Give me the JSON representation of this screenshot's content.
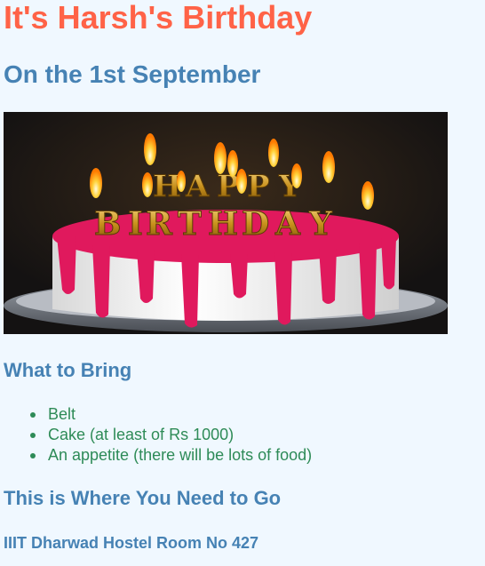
{
  "page": {
    "title": "It's Harsh's Birthday",
    "date": "On the 1st September",
    "image_alt": "Birthday cake with HAPPY BIRTHDAY candles",
    "what_to_bring": {
      "heading": "What to Bring",
      "items": [
        "Belt",
        "Cake (at least of Rs 1000)",
        "An appetite (there will be lots of food)"
      ]
    },
    "where": {
      "heading": "This is Where You Need to Go",
      "address": "IIIT Dharwad Hostel Room No 427"
    }
  },
  "colors": {
    "background": "#f0f8ff",
    "title": "#ff6347",
    "heading": "#4682b4",
    "list_text": "#2e8b57"
  }
}
